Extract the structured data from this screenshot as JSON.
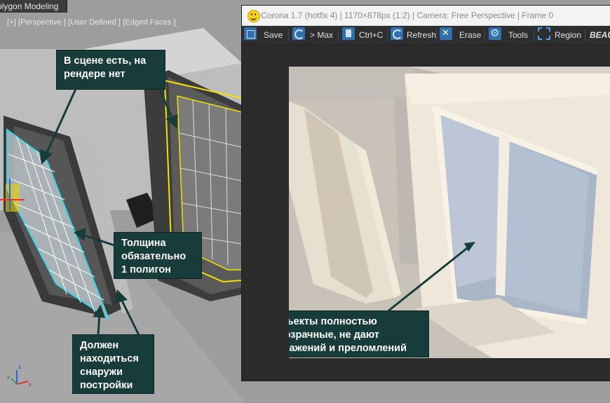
{
  "viewport": {
    "tab_label": "olygon Modeling",
    "label": "[+] [Perspective ] [User Defined ] [Edged Faces ]"
  },
  "vfb": {
    "title": "Corona 1.7 (hotfix 4) | 1170×878px (1:2) | Camera: Free Perspective | Frame 0",
    "toolbar": {
      "save": "Save",
      "to_max": "> Max",
      "copy": "Ctrl+C",
      "refresh": "Refresh",
      "erase": "Erase",
      "tools": "Tools",
      "region": "Region",
      "beauty": "BEAU"
    }
  },
  "callouts": {
    "top": "В сцене есть, на рендере нет",
    "middle": "Толщина обязательно 1 полигон",
    "bottom": "Должен находиться снаружи постройки",
    "right": "Объекты полностью прозрачные, не дают отражений и преломлений"
  },
  "axis": {
    "x": "x",
    "y": "y",
    "z": "z"
  },
  "colors": {
    "callout_bg": "#173c39",
    "selection_cyan": "#38d6ee",
    "selection_yellow": "#f2e400",
    "toolbar_blue": "#2f6fb2"
  }
}
